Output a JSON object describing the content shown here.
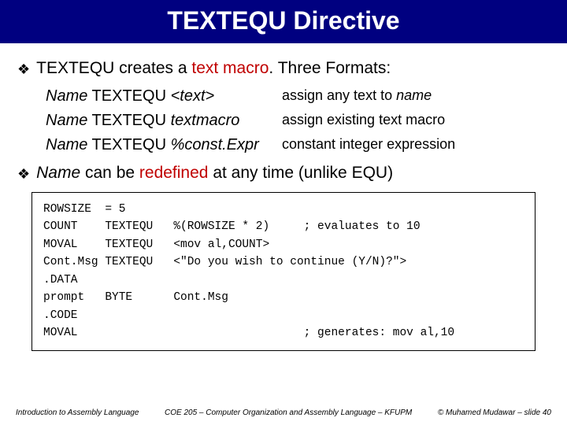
{
  "title": "TEXTEQU Directive",
  "bullet1": {
    "pre": "TEXTEQU creates a ",
    "red": "text macro",
    "post": ". Three Formats:"
  },
  "formats": [
    {
      "name": "Name",
      "kw": " TEXTEQU ",
      "arg": "<text>",
      "desc_pre": "assign any text to ",
      "desc_em": "name"
    },
    {
      "name": "Name",
      "kw": " TEXTEQU ",
      "arg": "textmacro",
      "desc_pre": "assign existing text macro",
      "desc_em": ""
    },
    {
      "name": "Name",
      "kw": " TEXTEQU ",
      "arg": "%const.Expr",
      "desc_pre": "constant integer expression",
      "desc_em": ""
    }
  ],
  "bullet2": {
    "em": "Name",
    "mid": " can be ",
    "red": "redefined",
    "post": " at any time (unlike EQU)"
  },
  "code": "ROWSIZE  = 5\nCOUNT    TEXTEQU   %(ROWSIZE * 2)     ; evaluates to 10\nMOVAL    TEXTEQU   <mov al,COUNT>\nCont.Msg TEXTEQU   <\"Do you wish to continue (Y/N)?\">\n.DATA\nprompt   BYTE      Cont.Msg\n.CODE\nMOVAL                                 ; generates: mov al,10",
  "footer": {
    "left": "Introduction to Assembly Language",
    "mid": "COE 205 – Computer Organization and Assembly Language – KFUPM",
    "right": "© Muhamed Mudawar – slide 40"
  }
}
